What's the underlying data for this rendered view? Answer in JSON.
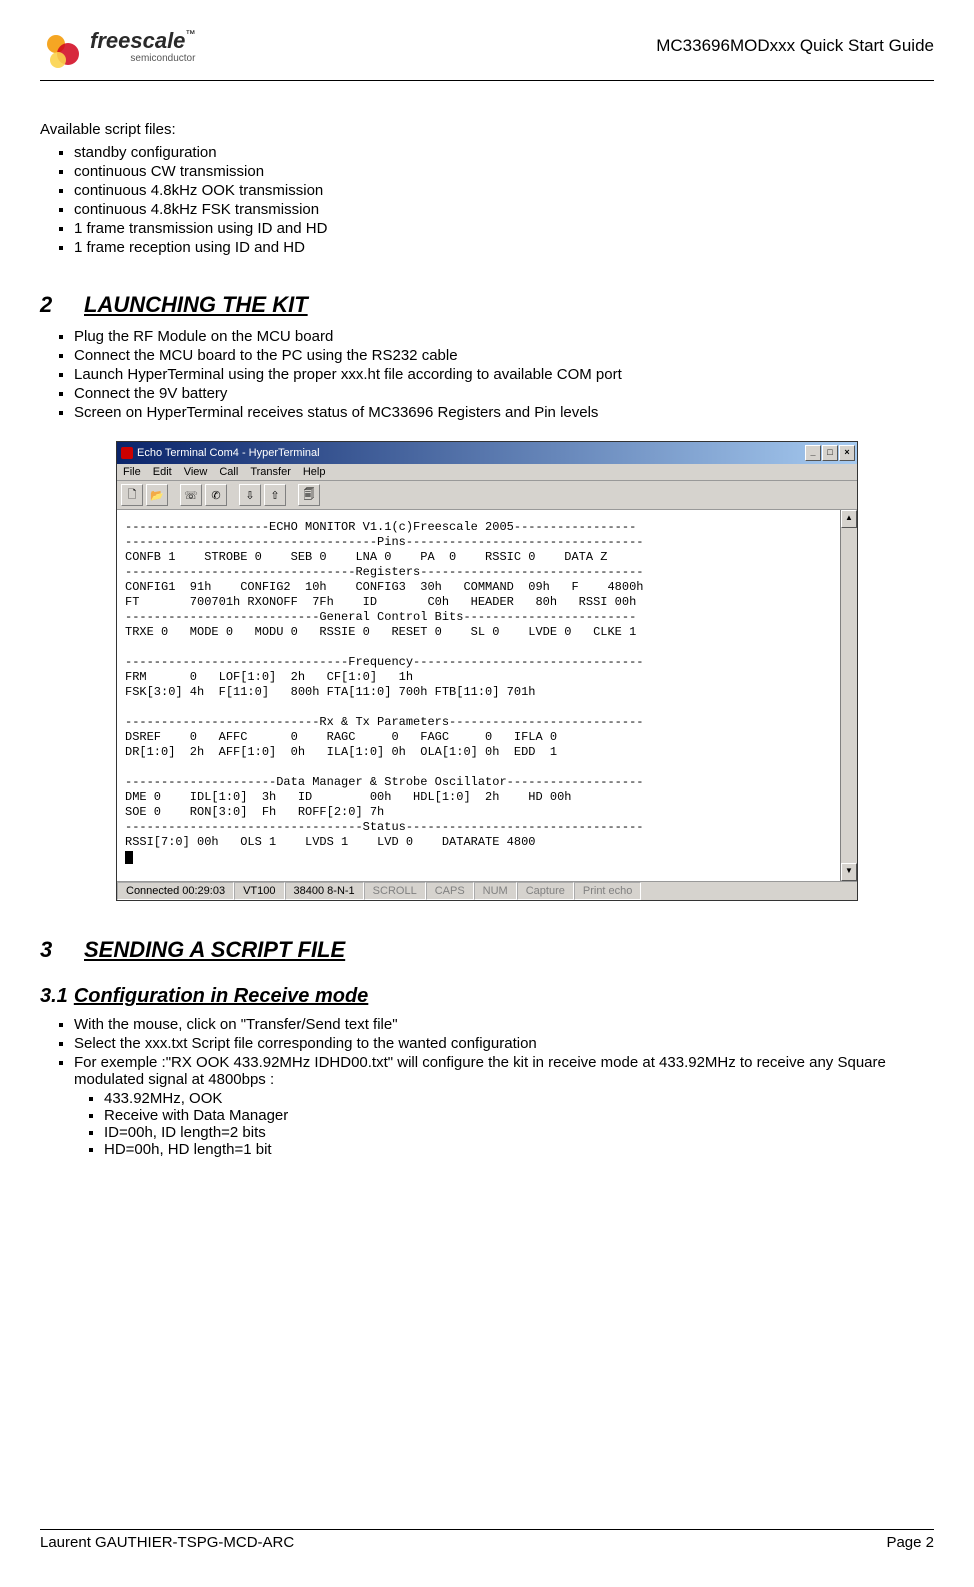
{
  "header": {
    "logo_main": "freescale",
    "logo_tm": "™",
    "logo_sub": "semiconductor",
    "doc_title": "MC33696MODxxx Quick Start Guide"
  },
  "intro_label": "Available script files:",
  "intro_items": [
    "standby configuration",
    "continuous CW transmission",
    "continuous 4.8kHz OOK transmission",
    "continuous 4.8kHz FSK transmission",
    "1 frame transmission using ID and HD",
    "1 frame reception using ID and HD"
  ],
  "section2": {
    "num": "2",
    "title": "LAUNCHING THE KIT",
    "items": [
      "Plug the RF Module on the MCU board",
      "Connect the MCU board to the PC using the RS232 cable",
      "Launch HyperTerminal using the proper xxx.ht file according to available COM port",
      "Connect the 9V battery",
      "Screen on HyperTerminal receives status of MC33696 Registers and Pin levels"
    ]
  },
  "screenshot": {
    "window_title": "Echo Terminal Com4 - HyperTerminal",
    "menu": [
      "File",
      "Edit",
      "View",
      "Call",
      "Transfer",
      "Help"
    ],
    "terminal_text": "--------------------ECHO MONITOR V1.1(c)Freescale 2005-----------------\n-----------------------------------Pins---------------------------------\nCONFB 1    STROBE 0    SEB 0    LNA 0    PA  0    RSSIC 0    DATA Z\n--------------------------------Registers-------------------------------\nCONFIG1  91h    CONFIG2  10h    CONFIG3  30h   COMMAND  09h   F    4800h\nFT       700701h RXONOFF  7Fh    ID       C0h   HEADER   80h   RSSI 00h\n---------------------------General Control Bits------------------------\nTRXE 0   MODE 0   MODU 0   RSSIE 0   RESET 0    SL 0    LVDE 0   CLKE 1\n\n-------------------------------Frequency--------------------------------\nFRM      0   LOF[1:0]  2h   CF[1:0]   1h\nFSK[3:0] 4h  F[11:0]   800h FTA[11:0] 700h FTB[11:0] 701h\n\n---------------------------Rx & Tx Parameters---------------------------\nDSREF    0   AFFC      0    RAGC     0   FAGC     0   IFLA 0\nDR[1:0]  2h  AFF[1:0]  0h   ILA[1:0] 0h  OLA[1:0] 0h  EDD  1\n\n---------------------Data Manager & Strobe Oscillator-------------------\nDME 0    IDL[1:0]  3h   ID        00h   HDL[1:0]  2h    HD 00h\nSOE 0    RON[3:0]  Fh   ROFF[2:0] 7h\n---------------------------------Status---------------------------------\nRSSI[7:0] 00h   OLS 1    LVDS 1    LVD 0    DATARATE 4800\n",
    "status": {
      "connected": "Connected 00:29:03",
      "emulation": "VT100",
      "settings": "38400 8-N-1",
      "dim": [
        "SCROLL",
        "CAPS",
        "NUM",
        "Capture",
        "Print echo"
      ]
    }
  },
  "section3": {
    "num": "3",
    "title": "SENDING A SCRIPT FILE",
    "sub": {
      "num": "3.1",
      "title": "Configuration in Receive mode"
    },
    "items": [
      "With the mouse, click on \"Transfer/Send text file\"",
      "Select the xxx.txt Script file corresponding to the wanted configuration",
      "For exemple :\"RX OOK 433.92MHz IDHD00.txt\" will configure the kit in receive mode at 433.92MHz to receive any Square modulated signal at 4800bps :"
    ],
    "nested": [
      "433.92MHz, OOK",
      "Receive with Data Manager",
      "ID=00h, ID length=2 bits",
      "HD=00h, HD length=1 bit"
    ]
  },
  "footer": {
    "left": "Laurent GAUTHIER-TSPG-MCD-ARC",
    "right": "Page 2"
  }
}
